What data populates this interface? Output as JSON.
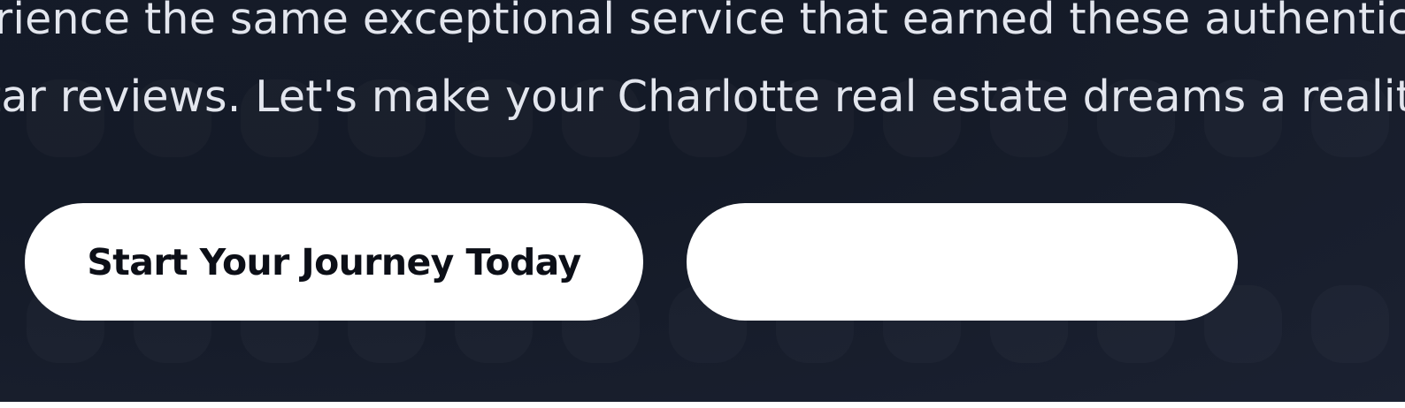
{
  "hero": {
    "description_lines": [
      "rience the same exceptional service that earned these authentic",
      "tar reviews. Let's make your Charlotte real estate dreams a reality."
    ],
    "primary_button_label": "Start Your Journey Today",
    "secondary_button_label": ""
  },
  "colors": {
    "background": "#161c29",
    "text": "#e3e6ee",
    "button_bg": "#ffffff",
    "button_text": "#0c0f17"
  }
}
